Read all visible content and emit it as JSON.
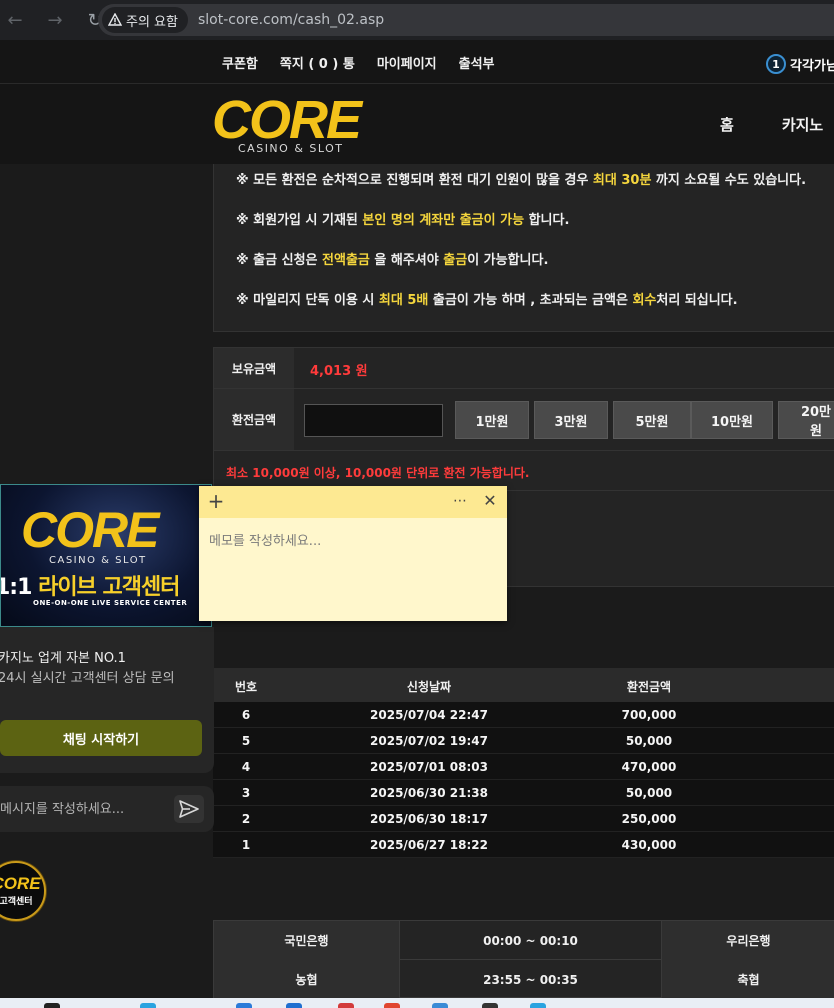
{
  "browser": {
    "security_label": "주의 요함",
    "url": "slot-core.com/cash_02.asp"
  },
  "site_nav": {
    "links": [
      "쿠폰함",
      "쪽지 ( 0 ) 통",
      "마이페이지",
      "출석부"
    ],
    "rank_number": "1",
    "rank_text": "각각가님"
  },
  "header": {
    "logo_text": "CORE",
    "logo_sub": "CASINO & SLOT",
    "menu": [
      "홈",
      "카지노"
    ]
  },
  "notice": {
    "lines": [
      {
        "pre": "※ 모든 환전은 순차적으로 진행되며 환전 대기 인원이 많을 경우 ",
        "hl": "최대 30분",
        "post": " 까지 소요될 수도 있습니다."
      },
      {
        "pre": "※ 회원가입 시 기재된 ",
        "hl": "본인 명의 계좌만 출금이 가능",
        "post": " 합니다."
      },
      {
        "pre": "※ 출금 신청은 ",
        "hl": "전액출금",
        "mid": " 을 해주셔야 ",
        "hl2": "출금",
        "post": "이 가능합니다."
      },
      {
        "pre": "※ 마일리지 단독 이용 시 ",
        "hl": "최대 5배",
        "mid": " 출금이 가능 하며 , 초과되는 금액은 ",
        "hl2": "회수",
        "post": "처리 되십니다."
      }
    ]
  },
  "form": {
    "balance_label": "보유금액",
    "balance_value": "4,013 원",
    "amount_label": "환전금액",
    "amount_value": "",
    "amount_buttons": [
      "1만원",
      "3만원",
      "5만원",
      "10만원",
      "20만원"
    ],
    "min_note_pre": "최소 ",
    "min_note_a": "10,000원",
    "min_note_mid": " 이상, ",
    "min_note_b": "10,000원",
    "min_note_post": " 단위로 환전 가능합니다."
  },
  "history": {
    "headers": {
      "no": "번호",
      "date": "신청날짜",
      "amount": "환전금액"
    },
    "rows": [
      {
        "no": "6",
        "date": "2025/07/04 22:47",
        "amount": "700,000"
      },
      {
        "no": "5",
        "date": "2025/07/02 19:47",
        "amount": "50,000"
      },
      {
        "no": "4",
        "date": "2025/07/01 08:03",
        "amount": "470,000"
      },
      {
        "no": "3",
        "date": "2025/06/30 21:38",
        "amount": "50,000"
      },
      {
        "no": "2",
        "date": "2025/06/30 18:17",
        "amount": "250,000"
      },
      {
        "no": "1",
        "date": "2025/06/27 18:22",
        "amount": "430,000"
      }
    ]
  },
  "banks": [
    {
      "bank": "국민은행",
      "hours": "00:00 ~ 00:10",
      "bank2": "우리은행"
    },
    {
      "bank": "농협",
      "hours": "23:55 ~ 00:35",
      "bank2": "축협"
    }
  ],
  "chat": {
    "banner_logo": "CORE",
    "banner_sub": "CASINO & SLOT",
    "banner_title_a": "1:1 ",
    "banner_title_b": "라이브 고객센터",
    "banner_eng": "ONE-ON-ONE LIVE SERVICE CENTER",
    "title": "카지노 업계 자본 NO.1",
    "desc": "24시 실시간 고객센터 상담 문의",
    "start_button": "채팅 시작하기",
    "message_placeholder": "메시지를 작성하세요...",
    "float_logo_word": "CORE",
    "float_logo_sub": "고객센터"
  },
  "sticky": {
    "placeholder": "메모를 작성하세요..."
  },
  "colors": {
    "accent_yellow": "#f5d63d",
    "alert_red": "#ff3b3b",
    "chat_button": "#5c6312",
    "sticky_note": "#fff7cc"
  }
}
